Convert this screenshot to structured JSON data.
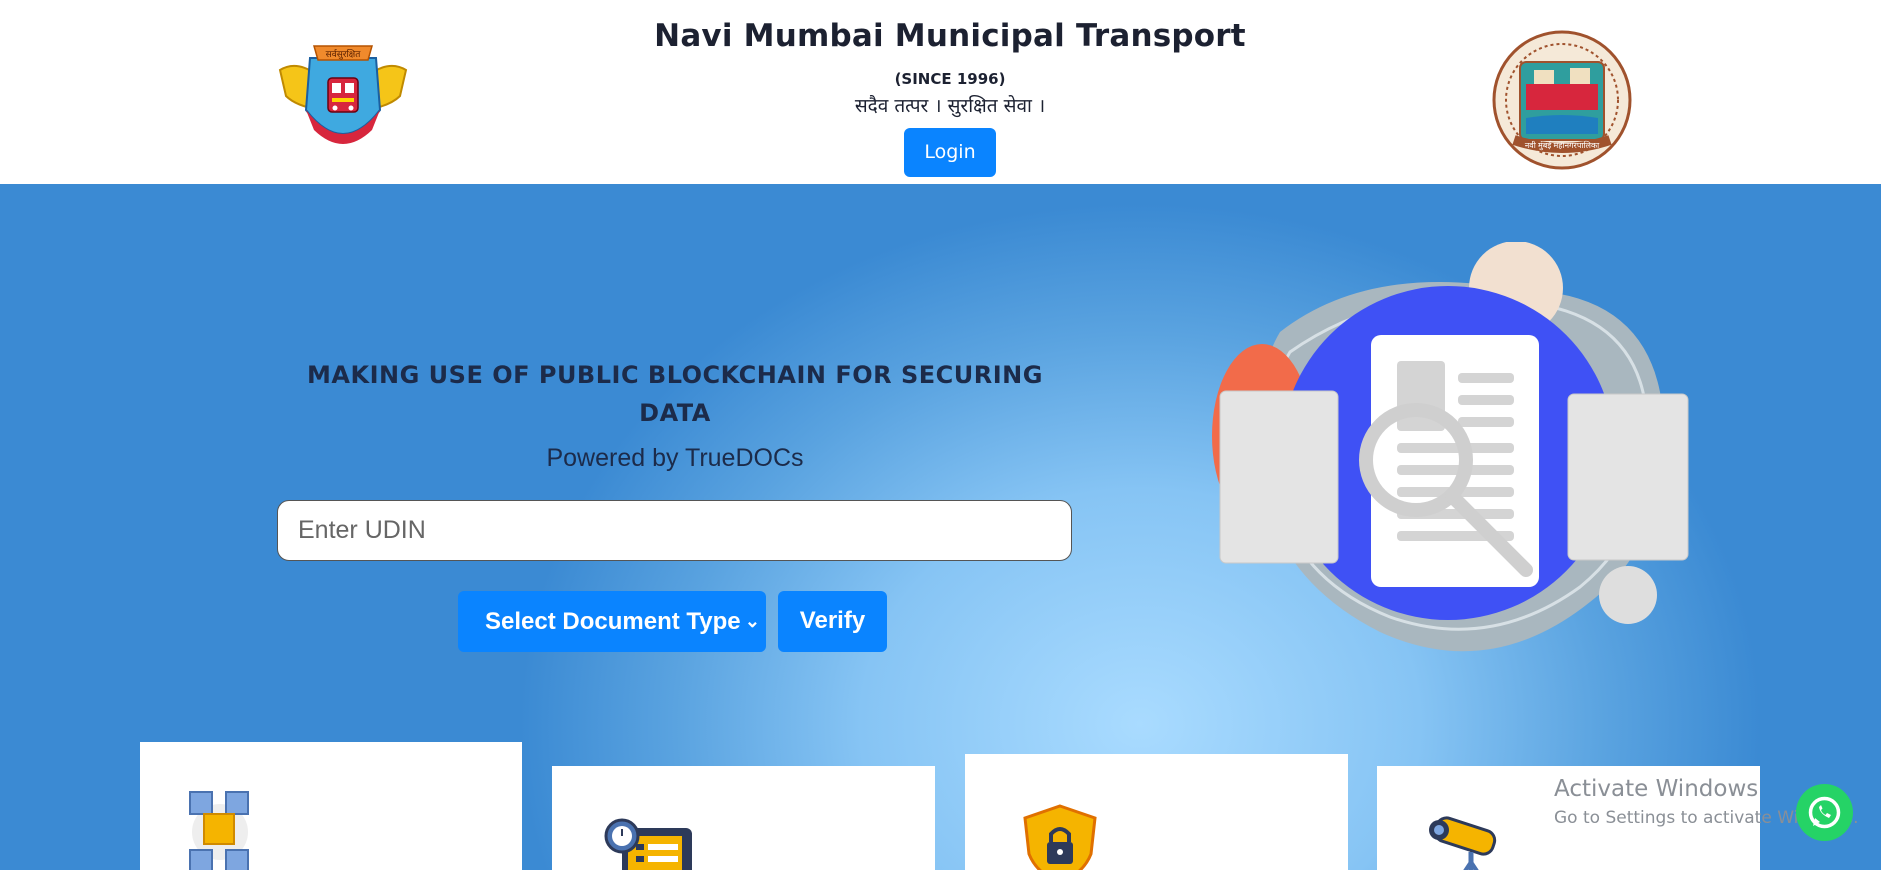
{
  "header": {
    "title": "Navi Mumbai Municipal Transport",
    "since": "(SINCE 1996)",
    "motto": "सदैव तत्पर । सुरक्षित सेवा ।",
    "login_label": "Login",
    "logo_left_text": "सर्वसुरक्षित",
    "logo_right_text": "नवी मुंबई महानगरपालिका"
  },
  "hero": {
    "title": "MAKING USE OF PUBLIC BLOCKCHAIN FOR SECURING DATA",
    "powered_by": "Powered by TrueDOCs",
    "udin_placeholder": "Enter UDIN",
    "select_label": "Select Document Type",
    "verify_label": "Verify"
  },
  "cards": [
    {
      "icon": "blockchain-cubes-icon"
    },
    {
      "icon": "clock-checklist-icon"
    },
    {
      "icon": "shield-lock-icon"
    },
    {
      "icon": "telescope-icon"
    }
  ],
  "overlay": {
    "activate_title": "Activate Windows",
    "activate_subtitle": "Go to Settings to activate Windows."
  },
  "colors": {
    "primary": "#0a84ff",
    "heading": "#1c2b4a",
    "whatsapp": "#25d366"
  }
}
